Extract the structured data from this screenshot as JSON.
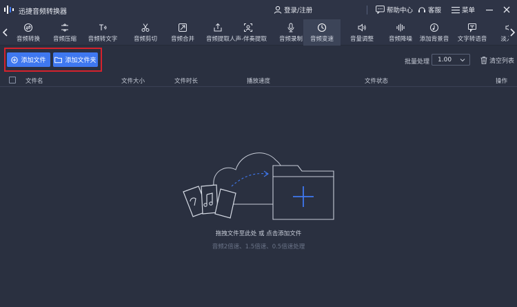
{
  "app": {
    "title": "迅捷音频转换器",
    "logo_icon": "audio-wave-logo"
  },
  "titlebar": {
    "login_label": "登录/注册",
    "help_label": "帮助中心",
    "service_label": "客服",
    "menu_label": "菜单"
  },
  "tools": [
    {
      "label": "音频转换",
      "icon": "convert-icon"
    },
    {
      "label": "音频压缩",
      "icon": "compress-icon"
    },
    {
      "label": "音频转文字",
      "icon": "speech-to-text-icon"
    },
    {
      "label": "音频剪切",
      "icon": "scissors-icon"
    },
    {
      "label": "音频合并",
      "icon": "merge-icon"
    },
    {
      "label": "音频提取",
      "icon": "extract-icon"
    },
    {
      "label": "人声-伴奏提取",
      "icon": "vocal-separate-icon"
    },
    {
      "label": "音频录制",
      "icon": "microphone-icon"
    },
    {
      "label": "音频变速",
      "icon": "speed-clock-icon",
      "active": true
    },
    {
      "label": "音量调整",
      "icon": "volume-icon"
    },
    {
      "label": "音频降噪",
      "icon": "noise-reduce-icon"
    },
    {
      "label": "添加背景音",
      "icon": "background-music-icon"
    },
    {
      "label": "文字转语音",
      "icon": "text-to-speech-icon"
    },
    {
      "label": "淡入淡",
      "icon": "fade-icon"
    }
  ],
  "actions": {
    "add_file_label": "添加文件",
    "add_folder_label": "添加文件夹",
    "batch_label": "批量处理",
    "batch_value": "1.00",
    "clear_label": "清空列表"
  },
  "table": {
    "columns": [
      "文件名",
      "文件大小",
      "文件时长",
      "播放速度",
      "文件状态",
      "操作"
    ]
  },
  "empty_state": {
    "main_text": "拖拽文件至此处 或 点击添加文件",
    "sub_text": "音频2倍速、1.5倍速、0.5倍速处理"
  },
  "colors": {
    "background": "#2a3040",
    "bar": "#2e3446",
    "accent_blue": "#3f78f0",
    "highlight_red": "#d6222c"
  }
}
